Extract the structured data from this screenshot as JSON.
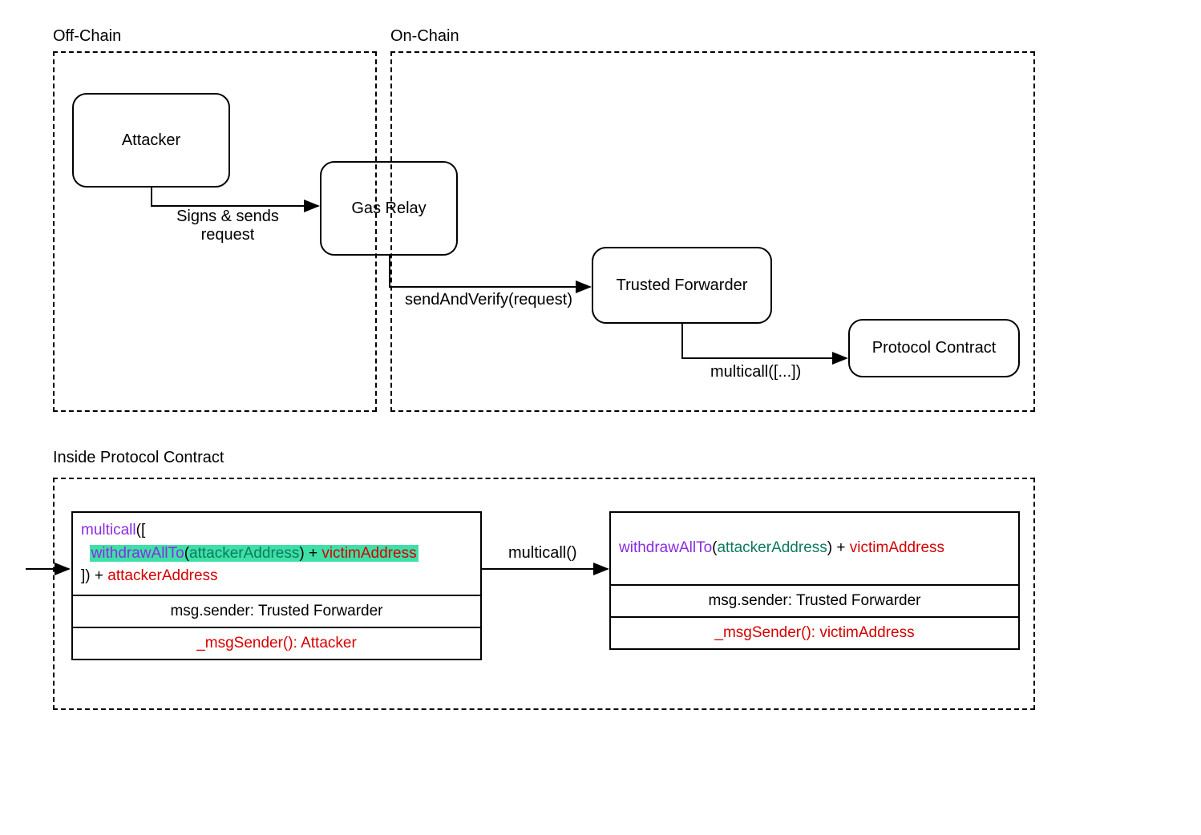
{
  "top": {
    "offchain_label": "Off-Chain",
    "onchain_label": "On-Chain",
    "attacker": "Attacker",
    "gas_relay": "Gas Relay",
    "trusted_forwarder": "Trusted Forwarder",
    "protocol_contract": "Protocol Contract",
    "arrow1": "Signs & sends request",
    "arrow2": "sendAndVerify(request)",
    "arrow3": "multicall([...])"
  },
  "bottom": {
    "title": "Inside Protocol Contract",
    "arrow_label": "multicall()",
    "left": {
      "multicall_open": "multicall",
      "bracket_open": "([",
      "withdraw_fn": "withdrawAllTo",
      "withdraw_arg_open": "(",
      "attacker_addr": "attackerAddress",
      "withdraw_arg_close": ")",
      "plus1": " + ",
      "victim_addr": "victimAddress",
      "bracket_close": "]) + ",
      "attacker_addr2": "attackerAddress",
      "row2": "msg.sender: Trusted Forwarder",
      "row3": "_msgSender(): Attacker"
    },
    "right": {
      "withdraw_fn": "withdrawAllTo",
      "paren_open": "(",
      "attacker_addr": "attackerAddress",
      "paren_close": ")",
      "plus": " + ",
      "victim_addr": "victimAddress",
      "row2": "msg.sender: Trusted Forwarder",
      "row3": "_msgSender(): victimAddress"
    }
  }
}
